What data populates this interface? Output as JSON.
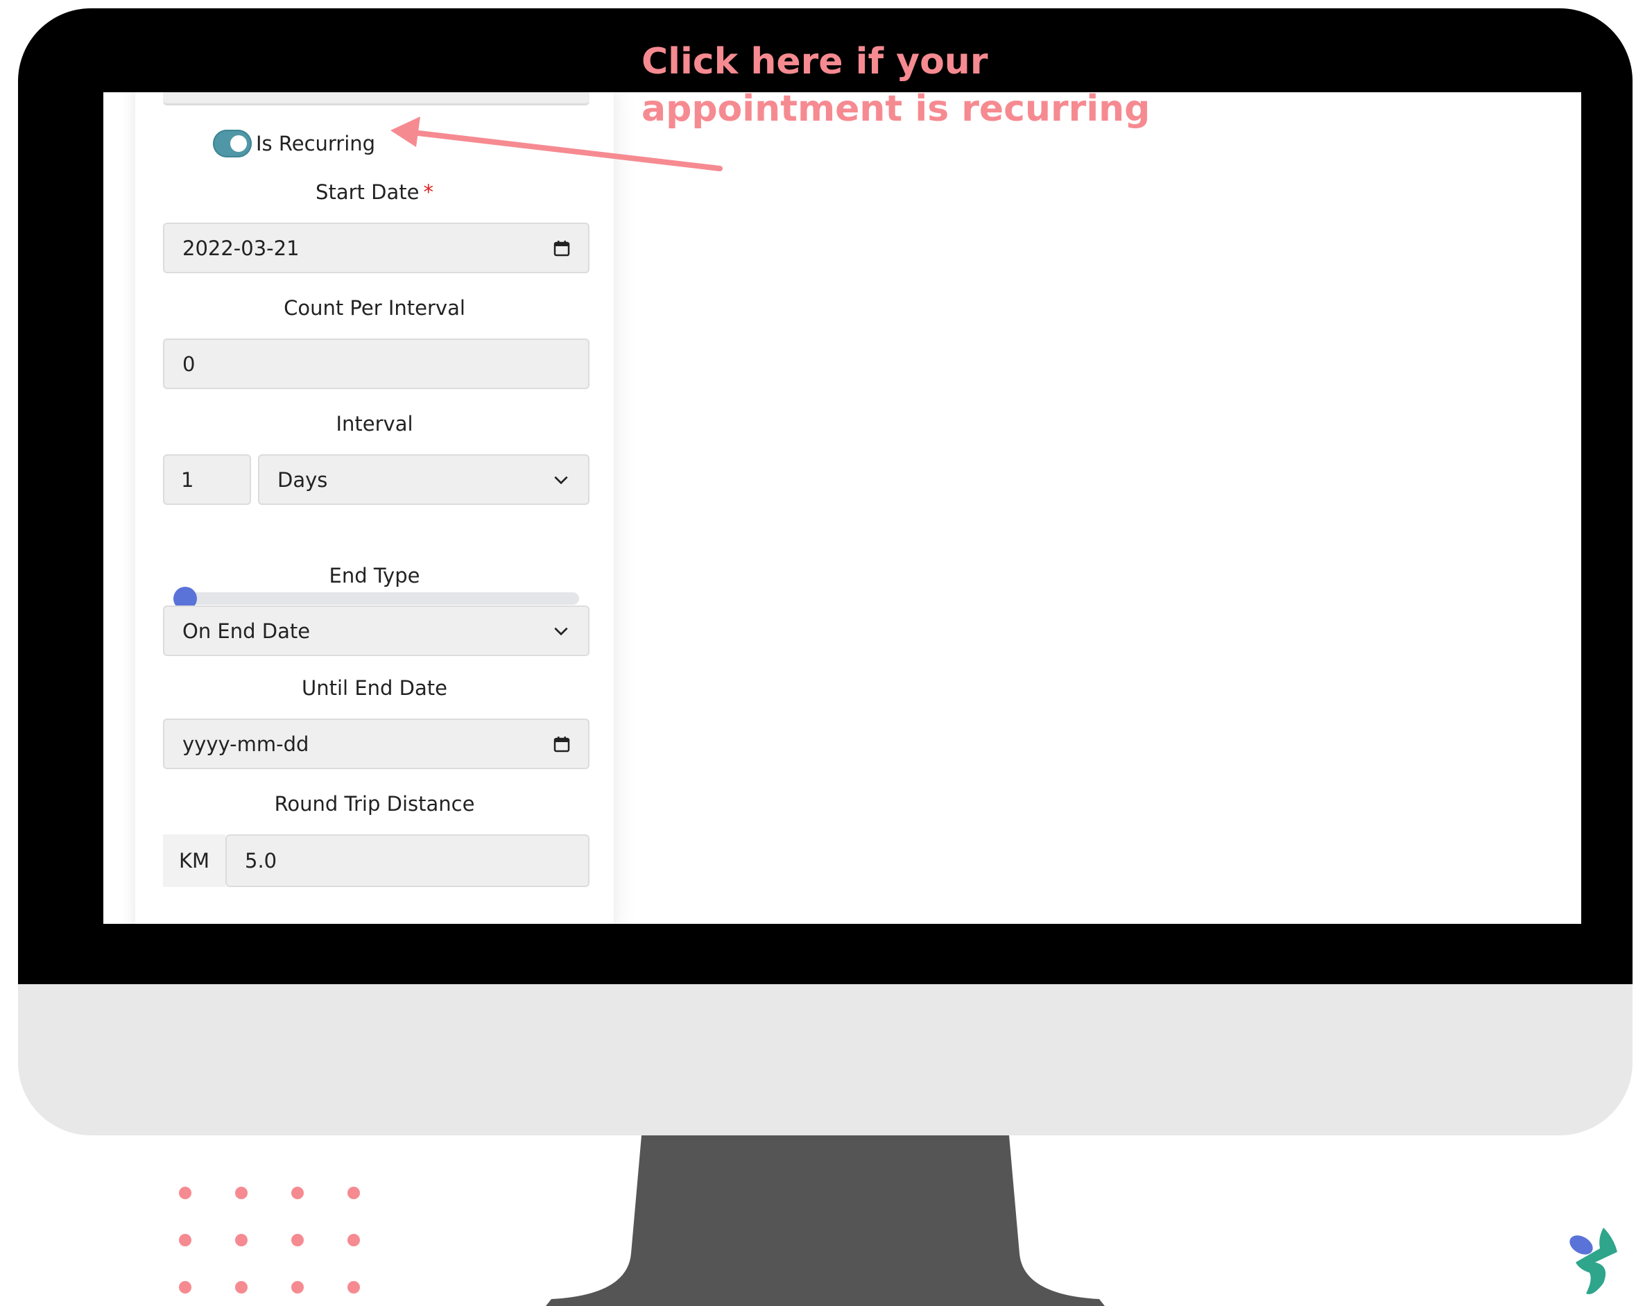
{
  "form": {
    "is_recurring": {
      "label": "Is Recurring",
      "checked": true
    },
    "start_date": {
      "label": "Start Date",
      "required_mark": "*",
      "value": "2022-03-21"
    },
    "count_per_interval": {
      "label": "Count Per Interval",
      "value": "0"
    },
    "interval": {
      "label": "Interval",
      "number": "1",
      "unit": "Days",
      "slider_fraction": 0.0
    },
    "end_type": {
      "label": "End Type",
      "value": "On End Date"
    },
    "until_end_date": {
      "label": "Until End Date",
      "placeholder": "yyyy-mm-dd"
    },
    "round_trip_distance": {
      "label": "Round Trip Distance",
      "unit": "KM",
      "value": "5.0"
    }
  },
  "annotation": {
    "line1": "Click here if your",
    "line2": "appointment is recurring",
    "color": "#f68a91"
  },
  "colors": {
    "toggle": "#4f97a6",
    "slider_thumb": "#5a73d8",
    "bezel": "#000000",
    "monitor_chin": "#e8e8e8",
    "stand": "#555555",
    "dots": "#f68a91"
  }
}
